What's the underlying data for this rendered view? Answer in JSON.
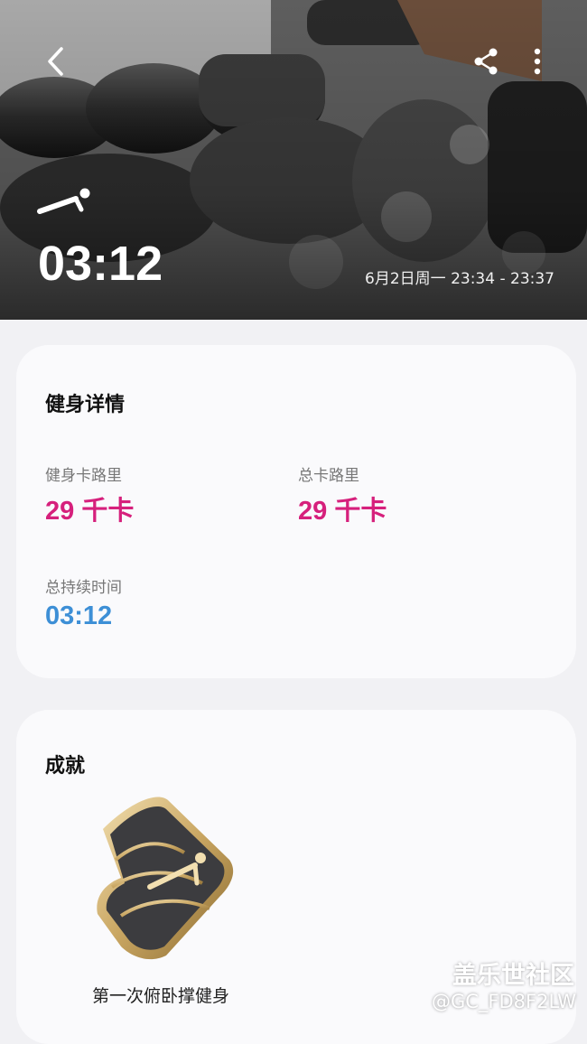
{
  "header": {
    "duration": "03:12",
    "date_range": "6月2日周一 23:34 - 23:37"
  },
  "details": {
    "title": "健身详情",
    "workout_calories": {
      "label": "健身卡路里",
      "value": "29 千卡"
    },
    "total_calories": {
      "label": "总卡路里",
      "value": "29 千卡"
    },
    "total_duration": {
      "label": "总持续时间",
      "value": "03:12"
    }
  },
  "achievements": {
    "title": "成就",
    "badge_label": "第一次俯卧撑健身"
  },
  "watermark": {
    "brand": "盖乐世社区",
    "user": "@GC_FD8F2LW"
  },
  "colors": {
    "calories_accent": "#d6207c",
    "duration_accent": "#3d8fd6"
  },
  "icons": [
    "back-arrow-icon",
    "share-icon",
    "more-vertical-icon",
    "pushup-icon",
    "pushup-badge-icon"
  ]
}
